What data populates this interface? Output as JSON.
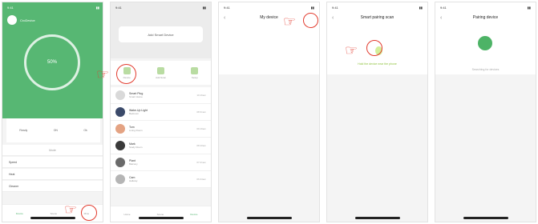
{
  "phone1": {
    "time": "9:41",
    "user_name": "CroDevice",
    "circle_text": "50%",
    "stats": [
      "Ready",
      "ON",
      "Ok"
    ],
    "section": "Mode",
    "rows": [
      "Speed",
      "Heat",
      "Cleaner"
    ],
    "tabs": [
      "Device",
      "Scene",
      "Mine"
    ]
  },
  "phone2": {
    "time": "9:41",
    "header_text": "Add Smart Device",
    "icons": [
      "Device",
      "Add Scan",
      "Setup"
    ],
    "devices": [
      {
        "name": "Smart Plug",
        "sub": "Smart Home",
        "time": "10:16am",
        "color": "#d9d9d9"
      },
      {
        "name": "Wake-Up Light",
        "sub": "Bedroom",
        "time": "08:31am",
        "color": "#3b4a6a"
      },
      {
        "name": "Tom",
        "sub": "Living Room",
        "time": "09:19am",
        "color": "#e4a383"
      },
      {
        "name": "Mark",
        "sub": "Study Room",
        "time": "08:10am",
        "color": "#3a3a3a"
      },
      {
        "name": "Plant",
        "sub": "Balcony",
        "time": "07:21am",
        "color": "#6a6a6a"
      },
      {
        "name": "Cam",
        "sub": "Hallway",
        "time": "06:44am",
        "color": "#b5b5b5"
      }
    ],
    "tabs": [
      "Home",
      "Scene",
      "Device"
    ]
  },
  "phone3": {
    "time": "9:41",
    "title": "My device",
    "back": "‹"
  },
  "phone4": {
    "time": "9:41",
    "title": "Smart pairing scan",
    "back": "‹",
    "hint": "Hold the device near the phone"
  },
  "phone5": {
    "time": "9:41",
    "title": "Pairing device",
    "back": "‹",
    "status": "Searching for devices"
  }
}
